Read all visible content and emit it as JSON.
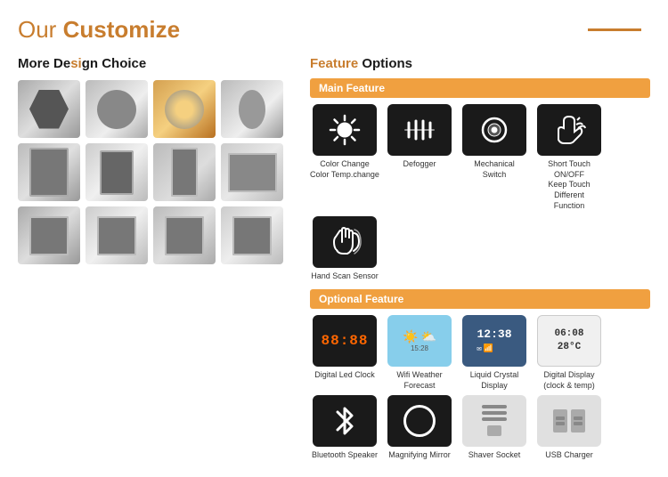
{
  "header": {
    "title_prefix": "Our ",
    "title_highlight": "Customize",
    "line": "—"
  },
  "left_section": {
    "title_plain": "More De",
    "title_highlight": "si",
    "title_rest": "gn Choice",
    "rows": [
      [
        "hexagon-mirror",
        "circle-mirror",
        "circle-light-mirror",
        "oval-mirror"
      ],
      [
        "rect-mirror-1",
        "rect-mirror-2",
        "tall-mirror",
        "wide-mirror"
      ],
      [
        "sq-mirror-1",
        "sq-mirror-2",
        "sq-mirror-3",
        "sq-mirror-4"
      ]
    ]
  },
  "right_section": {
    "title_plain": "",
    "title_highlight": "Feature",
    "title_rest": " Options",
    "main_feature": {
      "header": "Main Feature",
      "items": [
        {
          "label": "Color Change\nColor Temp.change",
          "icon": "brightness"
        },
        {
          "label": "Defogger",
          "icon": "defogger"
        },
        {
          "label": "Mechanical\nSwitch",
          "icon": "switch"
        },
        {
          "label": "Short Touch ON/OFF\nKeep Touch Different\nFunction",
          "icon": "touch"
        },
        {
          "label": "Hand Scan Sensor",
          "icon": "hand-scan"
        }
      ]
    },
    "optional_feature": {
      "header": "Optional Feature",
      "row1": [
        {
          "label": "Digital Led Clock",
          "icon": "digital-clock",
          "display": "88:88"
        },
        {
          "label": "Wifi Weather Forecast",
          "icon": "weather"
        },
        {
          "label": "Liquid Crystal Display",
          "icon": "lcd",
          "display": "12:38"
        },
        {
          "label": "Digital Display\n(clock & temp)",
          "icon": "digital-display",
          "display": "06:08\n28°C"
        }
      ],
      "row2": [
        {
          "label": "Bluetooth Speaker",
          "icon": "bluetooth"
        },
        {
          "label": "Magnifying Mirror",
          "icon": "magnify"
        },
        {
          "label": "Shaver Socket",
          "icon": "shaver"
        },
        {
          "label": "USB Charger",
          "icon": "usb"
        }
      ]
    }
  }
}
